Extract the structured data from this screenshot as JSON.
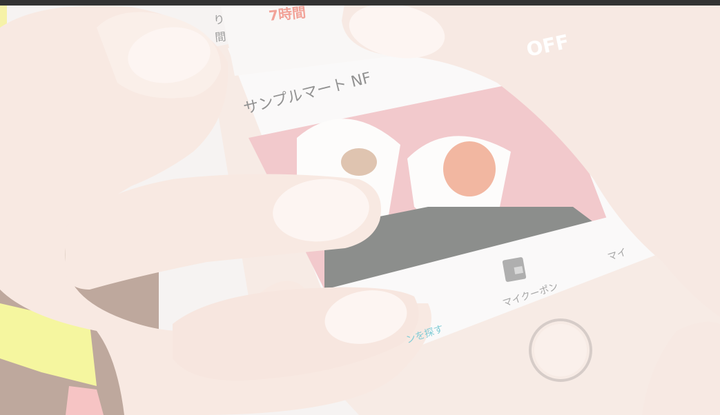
{
  "phone": {
    "top_left_text": "り\n間",
    "time_text": "7時間",
    "discount_badge": "OFF",
    "store_name": "サンプルマート NF",
    "nav_center_label": "マイクーポン",
    "nav_left_label": "ンを探す",
    "nav_right_label": "マイ"
  },
  "colors": {
    "accent_red": "#f07a6a",
    "pink_bg": "#e8a3a8",
    "seaweed": "#3a3d3a",
    "skin": "#f1ddd3",
    "screen_white": "#f7f5f4"
  }
}
